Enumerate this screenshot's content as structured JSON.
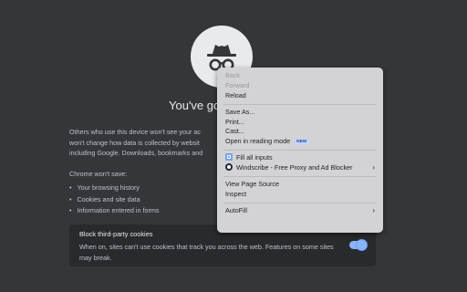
{
  "page": {
    "heading": "You've go",
    "paragraph": "Others who use this device won't see your ac\nwon't change how data is collected by websit\nincluding Google. Downloads, bookmarks and",
    "wont_save_title": "Chrome won't save:",
    "wont_save_items": [
      "Your browsing history",
      "Cookies and site data",
      "Information entered in forms"
    ],
    "cookie_card": {
      "title": "Block third-party cookies",
      "description": "When on, sites can't use cookies that track you across the web. Features on some sites may break.",
      "toggle_on": true
    }
  },
  "context_menu": {
    "back": "Back",
    "forward": "Forward",
    "reload": "Reload",
    "save_as": "Save As...",
    "print": "Print...",
    "cast": "Cast...",
    "reading_mode": "Open in reading mode",
    "new_badge": "NEW",
    "fill_all": "Fill all inputs",
    "windscribe": "Windscribe - Free Proxy and Ad Blocker",
    "view_source": "View Page Source",
    "inspect": "Inspect",
    "autofill": "AutoFill"
  },
  "icons": {
    "incognito": "incognito-icon",
    "fill": "fill-inputs-icon",
    "windscribe": "windscribe-icon",
    "submenu": "chevron-right-icon"
  },
  "colors": {
    "background": "#35363a",
    "card": "#292a2d",
    "menu": "#d3d3d5",
    "accent": "#8ab4f8"
  }
}
